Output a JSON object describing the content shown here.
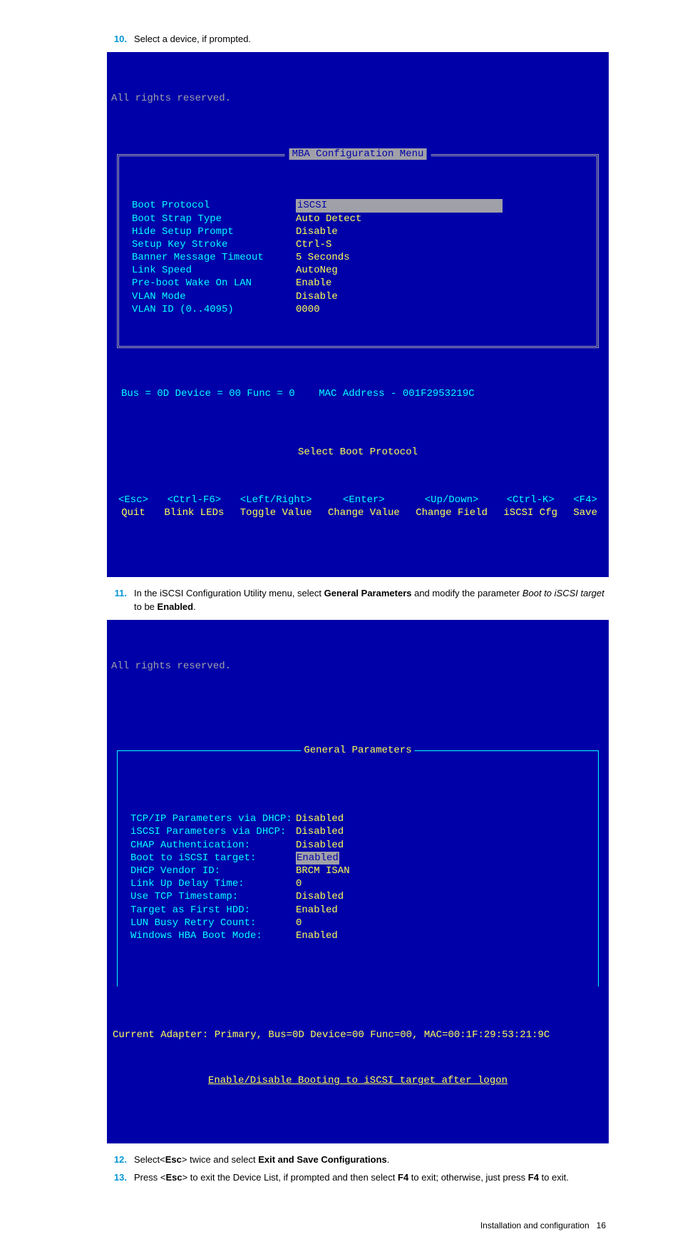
{
  "steps": {
    "n10": {
      "num": "10.",
      "text": "Select a device, if prompted."
    },
    "n11": {
      "num": "11.",
      "pre": "In the iSCSI Configuration Utility menu, select ",
      "bold1": "General Parameters",
      "mid": " and modify the parameter ",
      "ital": "Boot to iSCSI target",
      "post": " to be ",
      "bold2": "Enabled",
      "tail": "."
    },
    "n12": {
      "num": "12.",
      "pre": "Select<",
      "b1": "Esc",
      "mid": "> twice and select ",
      "b2": "Exit and Save Configurations",
      "post": "."
    },
    "n13": {
      "num": "13.",
      "pre": "Press <",
      "b1": "Esc",
      "mid1": "> to exit the Device List, if prompted and then select ",
      "b2": "F4",
      "mid2": " to exit; otherwise, just press ",
      "b3": "F4",
      "post": " to exit."
    }
  },
  "bios1": {
    "reserved": "All rights reserved.",
    "title": "MBA Configuration Menu",
    "rows": [
      {
        "label": "Boot Protocol",
        "value": "iSCSI",
        "selected": true
      },
      {
        "label": "Boot Strap Type",
        "value": "Auto Detect"
      },
      {
        "label": "Hide Setup Prompt",
        "value": "Disable"
      },
      {
        "label": "Setup Key Stroke",
        "value": "Ctrl-S"
      },
      {
        "label": "Banner Message Timeout",
        "value": "5 Seconds"
      },
      {
        "label": "Link Speed",
        "value": "AutoNeg"
      },
      {
        "label": "Pre-boot Wake On LAN",
        "value": "Enable"
      },
      {
        "label": "VLAN Mode",
        "value": "Disable"
      },
      {
        "label": "VLAN ID (0..4095)",
        "value": "0000"
      }
    ],
    "status": "Bus = 0D Device = 00 Func = 0    MAC Address - 001F2953219C",
    "hint": "Select Boot Protocol",
    "keys": [
      {
        "top": "<Esc>",
        "bot": "Quit"
      },
      {
        "top": "<Ctrl-F6>",
        "bot": "Blink LEDs"
      },
      {
        "top": "<Left/Right>",
        "bot": "Toggle Value"
      },
      {
        "top": "<Enter>",
        "bot": "Change Value"
      },
      {
        "top": "<Up/Down>",
        "bot": "Change Field"
      },
      {
        "top": "<Ctrl-K>",
        "bot": "iSCSI Cfg"
      },
      {
        "top": "<F4>",
        "bot": "Save"
      }
    ]
  },
  "bios2": {
    "reserved": "All rights reserved.",
    "title": "General Parameters",
    "rows": [
      {
        "label": "TCP/IP Parameters via DHCP:",
        "value": "Disabled"
      },
      {
        "label": "iSCSI Parameters via DHCP:",
        "value": "Disabled"
      },
      {
        "label": "CHAP Authentication:",
        "value": "Disabled"
      },
      {
        "label": "Boot to iSCSI target:",
        "value": "Enabled",
        "selected": true
      },
      {
        "label": "DHCP Vendor ID:",
        "value": "BRCM ISAN"
      },
      {
        "label": "Link Up Delay Time:",
        "value": "0"
      },
      {
        "label": "Use TCP Timestamp:",
        "value": "Disabled"
      },
      {
        "label": "Target as First HDD:",
        "value": "Enabled"
      },
      {
        "label": "LUN Busy Retry Count:",
        "value": "0"
      },
      {
        "label": "Windows HBA Boot Mode:",
        "value": "Enabled"
      }
    ],
    "adapter": "Current Adapter: Primary, Bus=0D Device=00 Func=00, MAC=00:1F:29:53:21:9C",
    "help": "Enable/Disable Booting to iSCSI target after logon"
  },
  "footer": {
    "section": "Installation and configuration",
    "page": "16"
  }
}
